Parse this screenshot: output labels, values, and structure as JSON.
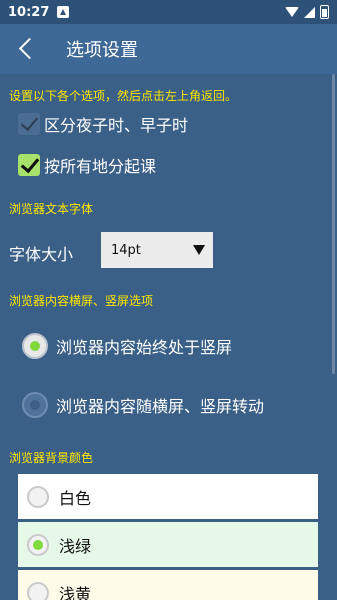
{
  "status_bar": {
    "time": "10:27"
  },
  "app_bar": {
    "title": "选项设置"
  },
  "hint": "设置以下各个选项，然后点击左上角返回。",
  "checkboxes": [
    {
      "label": "区分夜子时、早子时",
      "checked": false
    },
    {
      "label": "按所有地分起课",
      "checked": true
    }
  ],
  "browser_font": {
    "section_title": "浏览器文本字体",
    "size_label": "字体大小",
    "size_value": "14pt"
  },
  "orientation": {
    "section_title": "浏览器内容横屏、竖屏选项",
    "options": [
      {
        "label": "浏览器内容始终处于竖屏",
        "selected": true
      },
      {
        "label": "浏览器内容随横屏、竖屏转动",
        "selected": false
      }
    ]
  },
  "background": {
    "section_title": "浏览器背景颜色",
    "options": [
      {
        "label": "白色",
        "selected": false,
        "color": "#ffffff"
      },
      {
        "label": "浅绿",
        "selected": true,
        "color": "#e6f8e8"
      },
      {
        "label": "浅黄",
        "selected": false,
        "color": "#fffbe9"
      }
    ]
  },
  "colors": {
    "status_bar": "#2e5277",
    "app_bar": "#3e6895",
    "background": "#3b6088",
    "section_text": "#ffe600",
    "checkbox_on": "#a7e26a",
    "radio_selected": "#7fd93a"
  }
}
